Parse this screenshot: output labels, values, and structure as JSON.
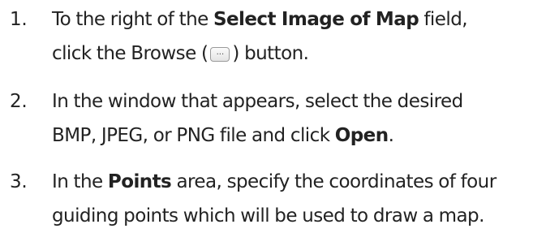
{
  "steps": [
    {
      "number": "1.",
      "line1": {
        "before": "To the right of the ",
        "bold": "Select Image of Map",
        "after": " field,"
      },
      "line2": {
        "before": "click the Browse (",
        "icon": "ellipsis-button-icon",
        "icon_glyph": "...",
        "after": ") button."
      }
    },
    {
      "number": "2.",
      "line1": {
        "text": "In the window that appears, select the desired"
      },
      "line2": {
        "before": "BMP, JPEG, or PNG file and click ",
        "bold": "Open",
        "after": "."
      }
    },
    {
      "number": "3.",
      "line1": {
        "before": "In the ",
        "bold": "Points",
        "after": " area, specify the coordinates of four"
      },
      "line2": {
        "text": "guiding points which will be used to draw a map."
      }
    }
  ]
}
